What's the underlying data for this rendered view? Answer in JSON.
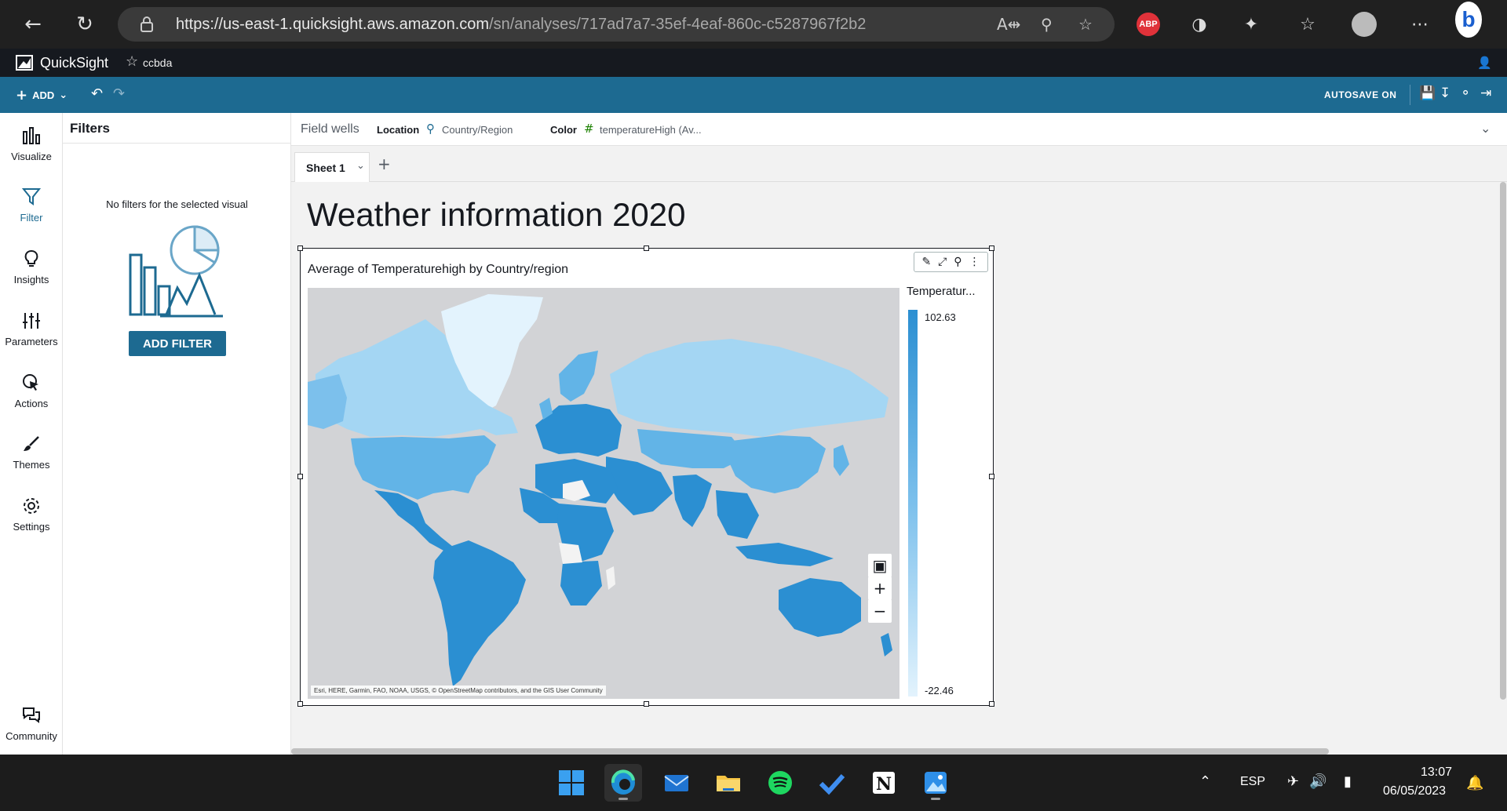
{
  "browser": {
    "url_host": "https://us-east-1.quicksight.aws.amazon.com",
    "url_path": "/sn/analyses/717ad7a7-35ef-4eaf-860c-c5287967f2b2",
    "abp_label": "ABP"
  },
  "app": {
    "name": "QuickSight",
    "analysis_name": "ccbda"
  },
  "toolbar": {
    "add_label": "ADD",
    "autosave_label": "AUTOSAVE ON"
  },
  "rail": {
    "items": [
      {
        "label": "Visualize",
        "icon": "bar-chart-icon"
      },
      {
        "label": "Filter",
        "icon": "funnel-icon"
      },
      {
        "label": "Insights",
        "icon": "lightbulb-icon"
      },
      {
        "label": "Parameters",
        "icon": "sliders-icon"
      },
      {
        "label": "Actions",
        "icon": "cursor-click-icon"
      },
      {
        "label": "Themes",
        "icon": "paintbrush-icon"
      },
      {
        "label": "Settings",
        "icon": "gear-icon"
      },
      {
        "label": "Community",
        "icon": "chat-bubbles-icon"
      }
    ]
  },
  "filters": {
    "title": "Filters",
    "empty_text": "No filters for the selected visual",
    "add_button": "ADD FILTER"
  },
  "field_wells": {
    "label": "Field wells",
    "location_name": "Location",
    "location_value": "Country/Region",
    "color_name": "Color",
    "color_value": "temperatureHigh (Av..."
  },
  "sheets": {
    "active_tab": "Sheet 1"
  },
  "sheet": {
    "title": "Weather information 2020"
  },
  "visual": {
    "title": "Average of Temperaturehigh by Country/region",
    "legend_title": "Temperatur...",
    "legend_max": "102.63",
    "legend_min": "-22.46",
    "attribution": "Esri, HERE, Garmin, FAO, NOAA, USGS, © OpenStreetMap contributors, and the GIS User Community",
    "colors": {
      "high": "#2b8fd2",
      "mid": "#7cc0ec",
      "low": "#e3f3fd",
      "nodata": "#f3f3f3",
      "ocean": "#d2d3d6"
    }
  },
  "taskbar": {
    "language": "ESP",
    "time": "13:07",
    "date": "06/05/2023"
  }
}
